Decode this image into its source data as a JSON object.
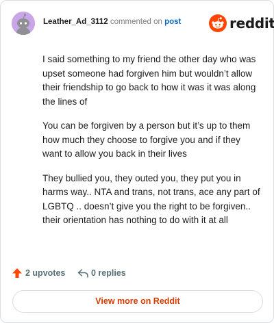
{
  "header": {
    "username": "Leather_Ad_3112",
    "action_text": "commented on",
    "post_link": "post",
    "brand": "reddit"
  },
  "comment": {
    "paragraphs": [
      "I said something to my friend the other day who was upset someone had forgiven him but wouldn’t allow their friendship to go back to how it was it was along the lines of",
      "You can be forgiven by a person but it’s up to them how much they choose to forgive you and if they want to allow you back in their lives",
      "They bullied you, they outed you, they put you in harms way.. NTA and trans, not trans, ace any part of LGBTQ .. doesn’t give you the right to be forgiven.. their orientation has nothing to do with it at all"
    ]
  },
  "stats": {
    "upvotes": "2 upvotes",
    "replies": "0 replies"
  },
  "footer": {
    "view_more": "View more on Reddit"
  },
  "colors": {
    "brand_orange": "#ff4500",
    "link_blue": "#0a66c2",
    "view_more_text": "#d93a00",
    "avatar_bg": "#c9a6e8"
  },
  "icons": {
    "avatar": "snoo-avatar-icon",
    "logo": "reddit-snoo-icon",
    "upvote": "upvote-arrow-icon",
    "reply": "reply-arrow-icon"
  }
}
